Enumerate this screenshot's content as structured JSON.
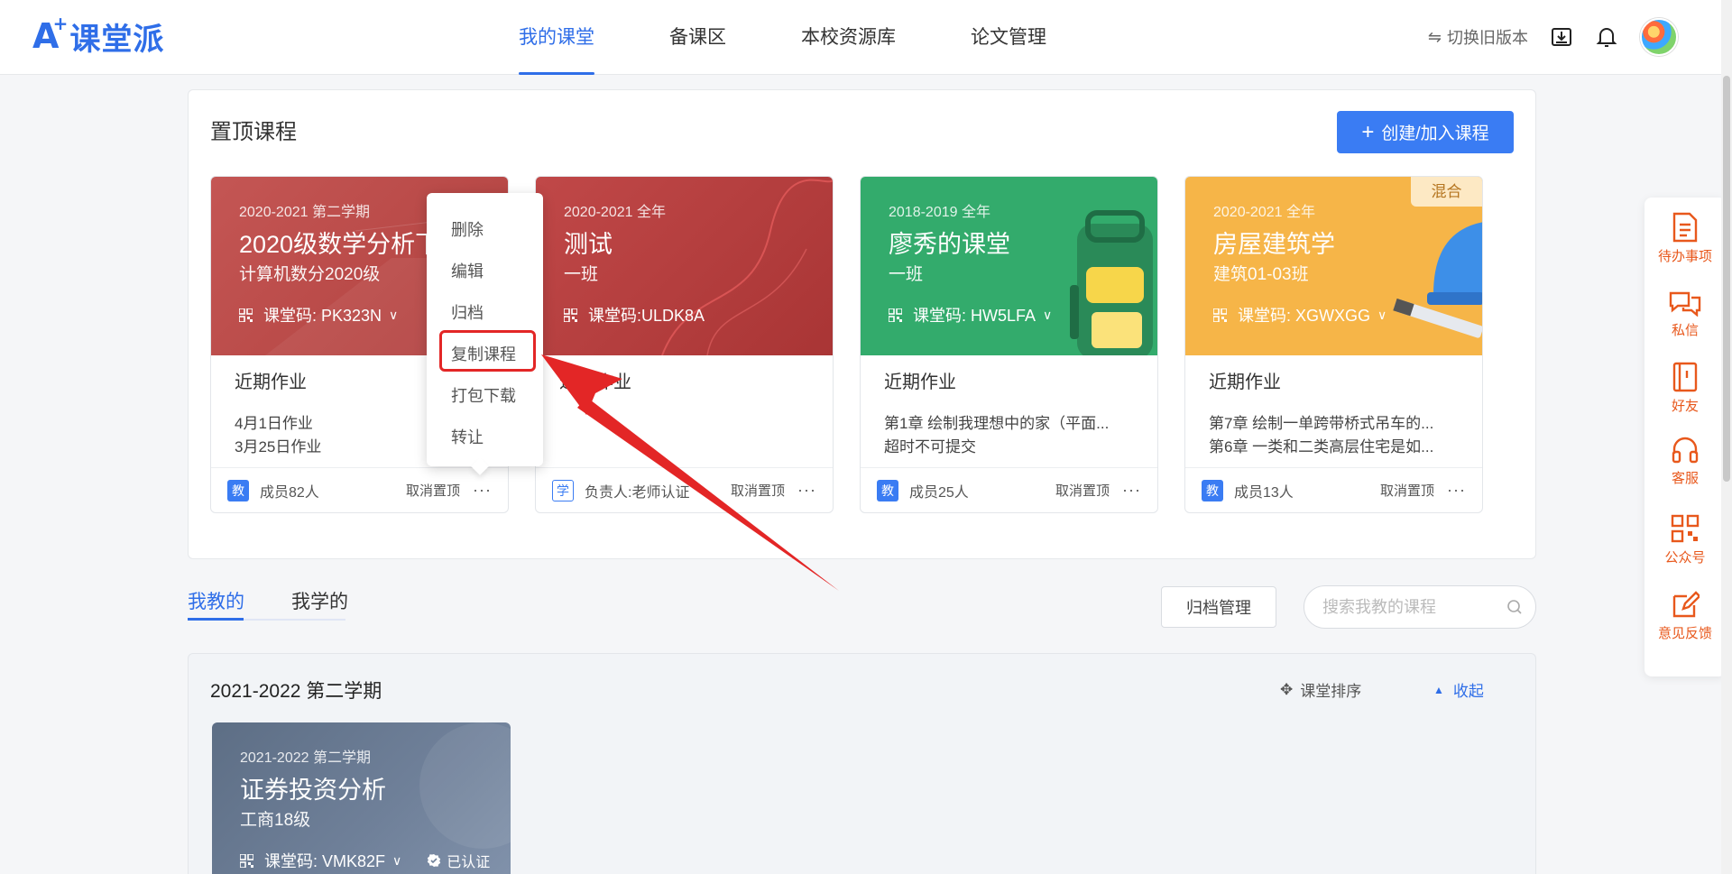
{
  "header": {
    "logo_a": "A",
    "logo_plus": "+",
    "logo_text": "课堂派",
    "nav": [
      "我的课堂",
      "备课区",
      "本校资源库",
      "论文管理"
    ],
    "switch_old": "切换旧版本"
  },
  "pinned": {
    "title": "置顶课程",
    "create_label": "创建/加入课程",
    "cards": [
      {
        "term": "2020-2021 第二学期",
        "name": "2020级数学分析下",
        "class": "计算机数分2020级",
        "code": "课堂码: PK323N",
        "homework_title": "近期作业",
        "homework": [
          "4月1日作业",
          "3月25日作业"
        ],
        "role": "教",
        "members": "成员82人",
        "unpin": "取消置顶",
        "more": "···"
      },
      {
        "term": "2020-2021 全年",
        "name": "测试",
        "class": "一班",
        "code": "课堂码:ULDK8A",
        "homework_title": "近期作业",
        "homework": [],
        "role": "学",
        "members": "负责人:老师认证",
        "unpin": "取消置顶",
        "more": "···"
      },
      {
        "term": "2018-2019 全年",
        "name": "廖秀的课堂",
        "class": "一班",
        "code": "课堂码: HW5LFA",
        "homework_title": "近期作业",
        "homework": [
          "第1章 绘制我理想中的家（平面...",
          "超时不可提交"
        ],
        "role": "教",
        "members": "成员25人",
        "unpin": "取消置顶",
        "more": "···"
      },
      {
        "term": "2020-2021 全年",
        "name": "房屋建筑学",
        "class": "建筑01-03班",
        "code": "课堂码: XGWXGG",
        "tag": "混合",
        "homework_title": "近期作业",
        "homework": [
          "第7章 绘制一单跨带桥式吊车的...",
          "第6章 一类和二类高层住宅是如..."
        ],
        "role": "教",
        "members": "成员13人",
        "unpin": "取消置顶",
        "more": "···"
      }
    ]
  },
  "menu": [
    "删除",
    "编辑",
    "归档",
    "复制课程",
    "打包下载",
    "转让"
  ],
  "tabs": [
    "我教的",
    "我学的"
  ],
  "archive_label": "归档管理",
  "search": {
    "placeholder": "搜索我教的课程"
  },
  "semester": {
    "title": "2021-2022 第二学期",
    "sort": "课堂排序",
    "fold": "收起",
    "card": {
      "term": "2021-2022 第二学期",
      "name": "证券投资分析",
      "class": "工商18级",
      "code": "课堂码: VMK82F",
      "verified": "已认证"
    }
  },
  "sidebar": [
    "待办事项",
    "私信",
    "好友",
    "客服",
    "公众号",
    "意见反馈"
  ],
  "colors": {
    "accent": "#2f6ee8",
    "card1": "#b94a48",
    "card2": "#b33a3a",
    "card3": "#2fa86a",
    "card4": "#f6b548",
    "highlight": "#e32626",
    "sidebar_icon": "#e8581c"
  }
}
